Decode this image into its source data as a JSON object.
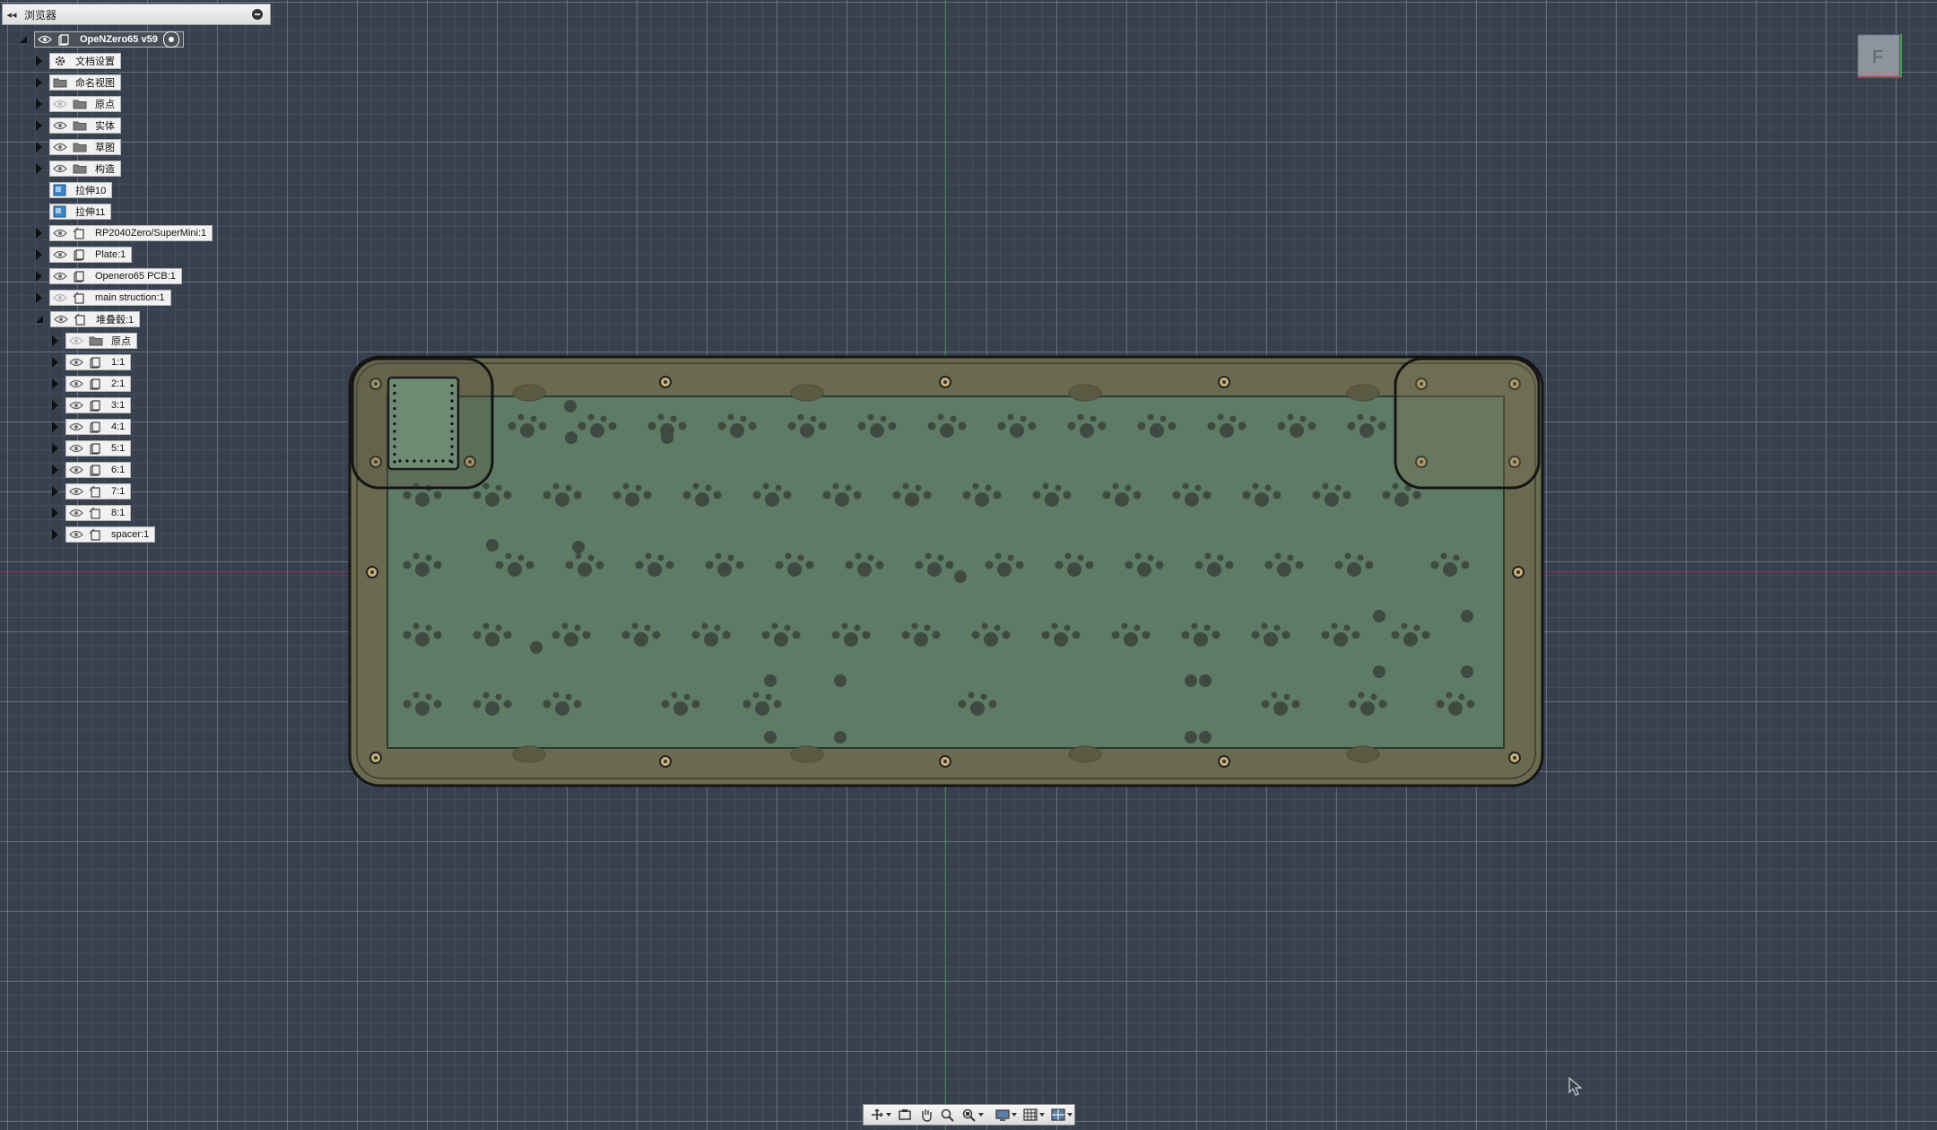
{
  "browser": {
    "title": "浏览器",
    "root": "OpeNZero65 v59",
    "items": [
      {
        "label": "文档设置"
      },
      {
        "label": "命名视图"
      },
      {
        "label": "原点"
      },
      {
        "label": "实体"
      },
      {
        "label": "草图"
      },
      {
        "label": "构造"
      },
      {
        "label": "拉伸10"
      },
      {
        "label": "拉伸11"
      },
      {
        "label": "RP2040Zero/SuperMini:1"
      },
      {
        "label": "Plate:1"
      },
      {
        "label": "Openero65 PCB:1"
      },
      {
        "label": "main struction:1"
      },
      {
        "label": "堆叠毂:1"
      },
      {
        "label": "原点"
      },
      {
        "label": "1:1"
      },
      {
        "label": "2:1"
      },
      {
        "label": "3:1"
      },
      {
        "label": "4:1"
      },
      {
        "label": "5:1"
      },
      {
        "label": "6:1"
      },
      {
        "label": "7:1"
      },
      {
        "label": "8:1"
      },
      {
        "label": "spacer:1"
      }
    ]
  },
  "colors": {
    "canvas": "#37404e",
    "case": "#6b6a4e",
    "plate": "#5f7c66",
    "x_axis": "#a8384a",
    "y_axis": "#3fa052"
  },
  "toolbar": {
    "icons": [
      "orbit-icon",
      "look-at-icon",
      "pan-icon",
      "zoom-icon",
      "zoom-window-icon",
      "display-settings-icon",
      "grid-icon",
      "viewports-icon"
    ]
  }
}
